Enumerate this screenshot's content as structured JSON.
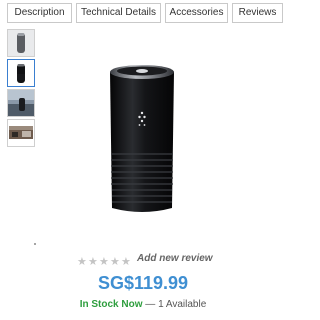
{
  "tabs": [
    {
      "label": "Description"
    },
    {
      "label": "Technical Details"
    },
    {
      "label": "Accessories"
    },
    {
      "label": "Reviews"
    }
  ],
  "thumbnails": [
    {
      "icon": "purifier-thumbnail-icon",
      "selected": false
    },
    {
      "icon": "purifier-thumbnail-icon",
      "selected": true
    },
    {
      "icon": "in-car-photo-thumbnail-icon",
      "selected": false
    },
    {
      "icon": "car-interior-thumbnail-icon",
      "selected": false
    }
  ],
  "product": {
    "image_icon": "car-air-purifier-icon"
  },
  "rating": {
    "stars_filled": 0,
    "stars_total": 5,
    "star_glyph": "★",
    "add_review_label": "Add new review"
  },
  "price": {
    "text": "SG$119.99"
  },
  "stock": {
    "status": "In Stock Now",
    "separator": " — ",
    "available": "1 Available"
  },
  "colors": {
    "price": "#3f8fd2",
    "in_stock": "#2e9e3e",
    "thumbnail_selected_border": "#3a7fd0"
  }
}
